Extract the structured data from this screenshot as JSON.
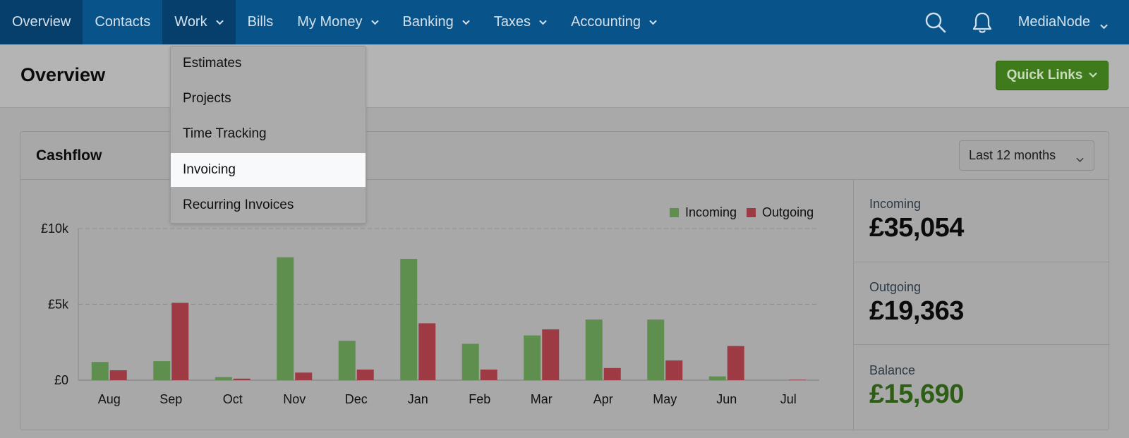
{
  "nav": {
    "items": [
      {
        "label": "Overview",
        "dropdown": false,
        "active": true
      },
      {
        "label": "Contacts",
        "dropdown": false,
        "active": false
      },
      {
        "label": "Work",
        "dropdown": true,
        "active": true
      },
      {
        "label": "Bills",
        "dropdown": false,
        "active": false
      },
      {
        "label": "My Money",
        "dropdown": true,
        "active": false
      },
      {
        "label": "Banking",
        "dropdown": true,
        "active": false
      },
      {
        "label": "Taxes",
        "dropdown": true,
        "active": false
      },
      {
        "label": "Accounting",
        "dropdown": true,
        "active": false
      }
    ],
    "icons": [
      "search-icon",
      "bell-icon"
    ],
    "user": "MediaNode"
  },
  "work_menu": {
    "items": [
      "Estimates",
      "Projects",
      "Time Tracking",
      "Invoicing",
      "Recurring Invoices"
    ],
    "highlighted": "Invoicing"
  },
  "header": {
    "title": "Overview",
    "quick_links": "Quick Links"
  },
  "cashflow": {
    "title": "Cashflow",
    "range": "Last 12 months"
  },
  "stats": {
    "incoming_label": "Incoming",
    "incoming_value": "£35,054",
    "outgoing_label": "Outgoing",
    "outgoing_value": "£19,363",
    "balance_label": "Balance",
    "balance_value": "£15,690"
  },
  "colors": {
    "nav_bg": "#08538a",
    "incoming": "#5e8f4e",
    "outgoing": "#9e3a44",
    "balance": "#2e5e16",
    "quick_links": "#3f7a1c"
  },
  "chart_data": {
    "type": "bar",
    "categories": [
      "Aug",
      "Sep",
      "Oct",
      "Nov",
      "Dec",
      "Jan",
      "Feb",
      "Mar",
      "Apr",
      "May",
      "Jun",
      "Jul"
    ],
    "series": [
      {
        "name": "Incoming",
        "values": [
          1200,
          1250,
          200,
          8100,
          2600,
          8000,
          2400,
          2950,
          4000,
          4000,
          250,
          0
        ]
      },
      {
        "name": "Outgoing",
        "values": [
          650,
          5100,
          100,
          500,
          700,
          3750,
          700,
          3350,
          800,
          1300,
          2250,
          30
        ]
      }
    ],
    "yticks": [
      {
        "value": 0,
        "label": "£0"
      },
      {
        "value": 5000,
        "label": "£5k"
      },
      {
        "value": 10000,
        "label": "£10k"
      }
    ],
    "ylim": [
      0,
      10000
    ],
    "grid": true,
    "legend": "top-right"
  }
}
